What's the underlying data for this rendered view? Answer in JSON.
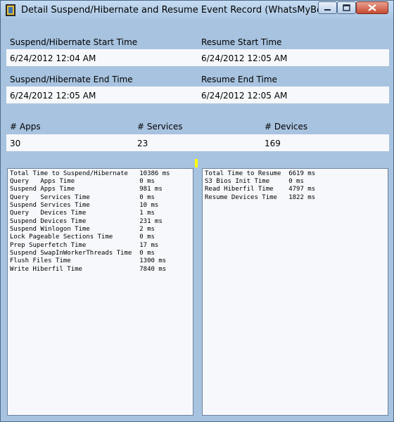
{
  "window": {
    "title": "Detail Suspend/Hibernate and Resume Event Record (WhatsMyBoot)",
    "icon": "whatsmyboot-app-icon"
  },
  "titlebar_buttons": [
    {
      "name": "minimize",
      "glyph": "─"
    },
    {
      "name": "maximize",
      "glyph": "□"
    },
    {
      "name": "close",
      "glyph": "✕"
    }
  ],
  "times": {
    "suspend_start_label": "Suspend/Hibernate Start Time",
    "suspend_start_value": "6/24/2012 12:04 AM",
    "resume_start_label": "Resume Start Time",
    "resume_start_value": "6/24/2012 12:05 AM",
    "suspend_end_label": "Suspend/Hibernate End Time",
    "suspend_end_value": "6/24/2012 12:05 AM",
    "resume_end_label": "Resume End Time",
    "resume_end_value": "6/24/2012 12:05 AM"
  },
  "counts": {
    "apps_label": "# Apps",
    "apps_value": "30",
    "services_label": "# Services",
    "services_value": "23",
    "devices_label": "# Devices",
    "devices_value": "169"
  },
  "suspend_stats": [
    "Total Time to Suspend/Hibernate   10386 ms",
    "Query   Apps Time                 0 ms",
    "Suspend Apps Time                 981 ms",
    "Query   Services Time             0 ms",
    "Suspend Services Time             10 ms",
    "Query   Devices Time              1 ms",
    "Suspend Devices Time              231 ms",
    "Suspend Winlogon Time             2 ms",
    "Lock Pageable Sections Time       0 ms",
    "Prep Superfetch Time              17 ms",
    "Suspend SwapInWorkerThreads Time  0 ms",
    "Flush Files Time                  1300 ms",
    "Write Hiberfil Time               7840 ms"
  ],
  "resume_stats": [
    "Total Time to Resume  6619 ms",
    "S3 Bios Init Time     0 ms",
    "Read Hiberfil Time    4797 ms",
    "Resume Devices Time   1822 ms"
  ],
  "colors": {
    "client_bg": "#a8c3df",
    "value_bg": "#f7f8fb",
    "splitter_marker": "#ffff00"
  }
}
